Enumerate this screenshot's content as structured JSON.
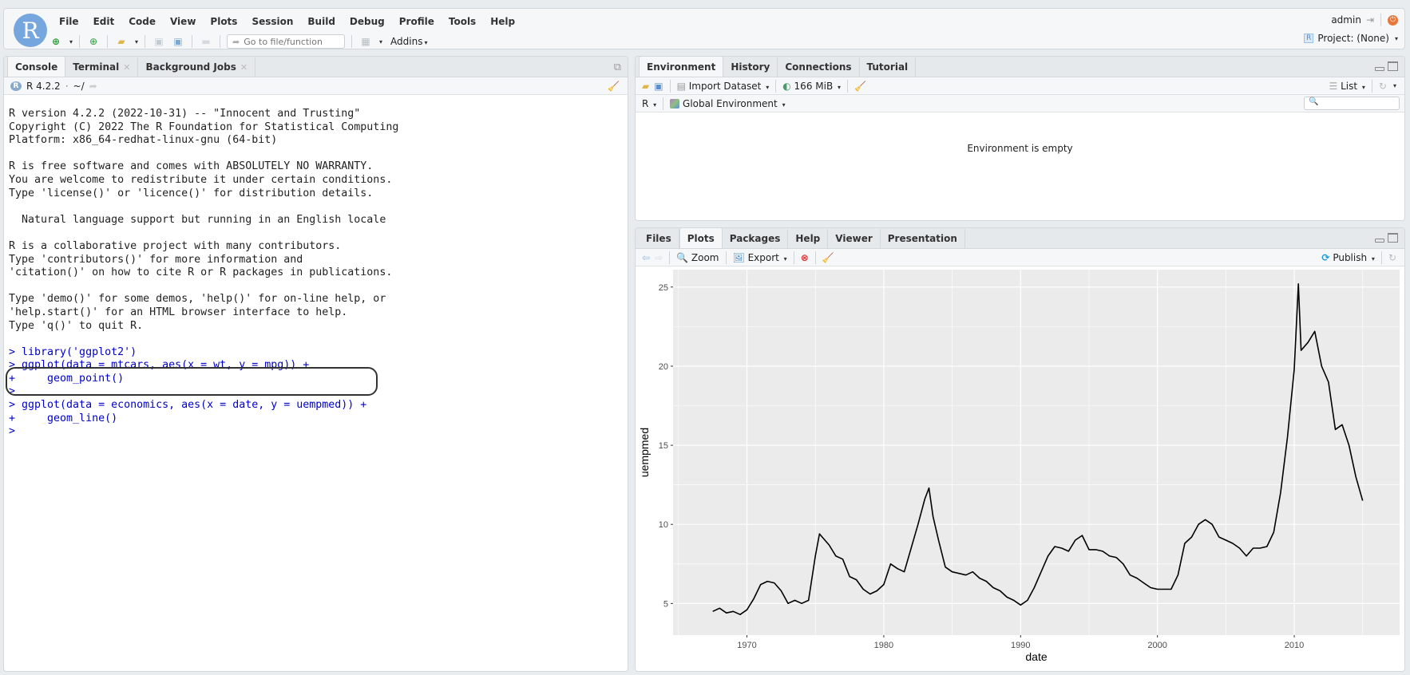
{
  "app": {
    "logo_letter": "R",
    "menu": [
      "File",
      "Edit",
      "Code",
      "View",
      "Plots",
      "Session",
      "Build",
      "Debug",
      "Profile",
      "Tools",
      "Help"
    ],
    "goto_placeholder": "Go to file/function",
    "addins_label": "Addins",
    "user": "admin",
    "project_label": "Project: (None)"
  },
  "console_pane": {
    "tabs": [
      {
        "label": "Console",
        "active": true,
        "closable": false
      },
      {
        "label": "Terminal",
        "active": false,
        "closable": true
      },
      {
        "label": "Background Jobs",
        "active": false,
        "closable": true
      }
    ],
    "r_version_label": "R 4.2.2",
    "working_dir": "~/",
    "lines": [
      {
        "text": "R version 4.2.2 (2022-10-31) -- \"Innocent and Trusting\"",
        "type": "out"
      },
      {
        "text": "Copyright (C) 2022 The R Foundation for Statistical Computing",
        "type": "out"
      },
      {
        "text": "Platform: x86_64-redhat-linux-gnu (64-bit)",
        "type": "out"
      },
      {
        "text": "",
        "type": "out"
      },
      {
        "text": "R is free software and comes with ABSOLUTELY NO WARRANTY.",
        "type": "out"
      },
      {
        "text": "You are welcome to redistribute it under certain conditions.",
        "type": "out"
      },
      {
        "text": "Type 'license()' or 'licence()' for distribution details.",
        "type": "out"
      },
      {
        "text": "",
        "type": "out"
      },
      {
        "text": "  Natural language support but running in an English locale",
        "type": "out"
      },
      {
        "text": "",
        "type": "out"
      },
      {
        "text": "R is a collaborative project with many contributors.",
        "type": "out"
      },
      {
        "text": "Type 'contributors()' for more information and",
        "type": "out"
      },
      {
        "text": "'citation()' on how to cite R or R packages in publications.",
        "type": "out"
      },
      {
        "text": "",
        "type": "out"
      },
      {
        "text": "Type 'demo()' for some demos, 'help()' for on-line help, or",
        "type": "out"
      },
      {
        "text": "'help.start()' for an HTML browser interface to help.",
        "type": "out"
      },
      {
        "text": "Type 'q()' to quit R.",
        "type": "out"
      },
      {
        "text": "",
        "type": "out"
      },
      {
        "text": "> library('ggplot2')",
        "type": "cmd"
      },
      {
        "text": "> ggplot(data = mtcars, aes(x = wt, y = mpg)) +",
        "type": "cmd"
      },
      {
        "text": "+     geom_point()",
        "type": "cmd"
      },
      {
        "text": ">",
        "type": "cmd"
      },
      {
        "text": "> ggplot(data = economics, aes(x = date, y = uempmed)) +",
        "type": "cmd"
      },
      {
        "text": "+     geom_line()",
        "type": "cmd"
      },
      {
        "text": ">",
        "type": "cmd"
      }
    ]
  },
  "env_pane": {
    "tabs": [
      {
        "label": "Environment",
        "active": true
      },
      {
        "label": "History",
        "active": false
      },
      {
        "label": "Connections",
        "active": false
      },
      {
        "label": "Tutorial",
        "active": false
      }
    ],
    "import_dataset_label": "Import Dataset",
    "memory_label": "166 MiB",
    "view_mode_label": "List",
    "language_label": "R",
    "scope_label": "Global Environment",
    "empty_message": "Environment is empty",
    "search_placeholder": ""
  },
  "plots_pane": {
    "tabs": [
      {
        "label": "Files",
        "active": false
      },
      {
        "label": "Plots",
        "active": true
      },
      {
        "label": "Packages",
        "active": false
      },
      {
        "label": "Help",
        "active": false
      },
      {
        "label": "Viewer",
        "active": false
      },
      {
        "label": "Presentation",
        "active": false
      }
    ],
    "zoom_label": "Zoom",
    "export_label": "Export",
    "publish_label": "Publish"
  },
  "colors": {
    "accent_blue": "#75a6dd",
    "command_text": "#0000c8",
    "plot_bg": "#ebebeb",
    "grid": "#ffffff",
    "publish_icon": "#1a9bd7",
    "power_icon": "#e8783a"
  },
  "chart_data": {
    "type": "line",
    "title": "",
    "xlabel": "date",
    "ylabel": "uempmed",
    "x_ticks": [
      1970,
      1980,
      1990,
      2000,
      2010
    ],
    "y_ticks": [
      5,
      10,
      15,
      20,
      25
    ],
    "xlim": [
      1964.6,
      2017.7
    ],
    "ylim": [
      3.0,
      26.1
    ],
    "grid": true,
    "legend": "none",
    "series": [
      {
        "name": "uempmed",
        "x": [
          1967.5,
          1968.0,
          1968.5,
          1969.0,
          1969.5,
          1970.0,
          1970.5,
          1971.0,
          1971.5,
          1972.0,
          1972.5,
          1973.0,
          1973.5,
          1974.0,
          1974.5,
          1975.0,
          1975.3,
          1975.5,
          1976.0,
          1976.5,
          1977.0,
          1977.5,
          1978.0,
          1978.5,
          1979.0,
          1979.5,
          1980.0,
          1980.5,
          1981.0,
          1981.5,
          1982.0,
          1982.5,
          1983.0,
          1983.3,
          1983.6,
          1984.0,
          1984.5,
          1985.0,
          1985.5,
          1986.0,
          1986.5,
          1987.0,
          1987.5,
          1988.0,
          1988.5,
          1989.0,
          1989.5,
          1990.0,
          1990.5,
          1991.0,
          1991.5,
          1992.0,
          1992.5,
          1993.0,
          1993.5,
          1994.0,
          1994.5,
          1995.0,
          1995.5,
          1996.0,
          1996.5,
          1997.0,
          1997.5,
          1998.0,
          1998.5,
          1999.0,
          1999.5,
          2000.0,
          2000.5,
          2001.0,
          2001.5,
          2002.0,
          2002.5,
          2003.0,
          2003.5,
          2004.0,
          2004.5,
          2005.0,
          2005.5,
          2006.0,
          2006.5,
          2007.0,
          2007.5,
          2008.0,
          2008.5,
          2009.0,
          2009.5,
          2010.0,
          2010.3,
          2010.5,
          2011.0,
          2011.5,
          2012.0,
          2012.5,
          2013.0,
          2013.5,
          2014.0,
          2014.5,
          2015.0
        ],
        "values": [
          4.5,
          4.7,
          4.4,
          4.5,
          4.3,
          4.6,
          5.3,
          6.2,
          6.4,
          6.3,
          5.8,
          5.0,
          5.2,
          5.0,
          5.2,
          8.0,
          9.4,
          9.2,
          8.7,
          8.0,
          7.8,
          6.7,
          6.5,
          5.9,
          5.6,
          5.8,
          6.2,
          7.5,
          7.2,
          7.0,
          8.5,
          10.0,
          11.6,
          12.3,
          10.5,
          9.0,
          7.3,
          7.0,
          6.9,
          6.8,
          7.0,
          6.6,
          6.4,
          6.0,
          5.8,
          5.4,
          5.2,
          4.9,
          5.2,
          6.0,
          7.0,
          8.0,
          8.6,
          8.5,
          8.3,
          9.0,
          9.3,
          8.4,
          8.4,
          8.3,
          8.0,
          7.9,
          7.5,
          6.8,
          6.6,
          6.3,
          6.0,
          5.9,
          5.9,
          5.9,
          6.8,
          8.8,
          9.2,
          10.0,
          10.3,
          10.0,
          9.2,
          9.0,
          8.8,
          8.5,
          8.0,
          8.5,
          8.5,
          8.6,
          9.5,
          12.0,
          15.5,
          19.8,
          25.2,
          21.0,
          21.5,
          22.2,
          20.0,
          19.0,
          16.0,
          16.3,
          15.0,
          13.0,
          11.5
        ]
      }
    ]
  }
}
